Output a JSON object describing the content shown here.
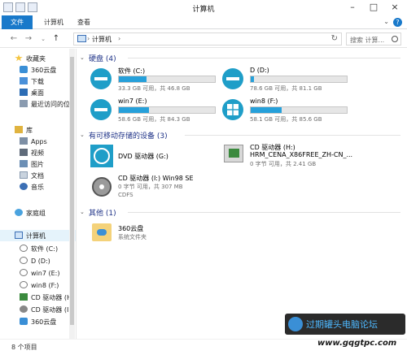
{
  "window": {
    "title": "计算机"
  },
  "ribbon": {
    "tabs": [
      "文件",
      "计算机",
      "查看"
    ]
  },
  "address": {
    "crumb": "计算机",
    "sep1": "›",
    "sep2": "›"
  },
  "search": {
    "placeholder": "搜索 计算..."
  },
  "sidebar": {
    "favorites": "收藏夹",
    "fav_items": [
      "360云盘",
      "下载",
      "桌面",
      "最近访问的位"
    ],
    "libraries": "库",
    "lib_items": [
      "Apps",
      "视频",
      "图片",
      "文档",
      "音乐"
    ],
    "homegroup": "家庭组",
    "computer": "计算机",
    "drives": [
      "软件 (C:)",
      "D (D:)",
      "win7 (E:)",
      "win8 (F:)",
      "CD 驱动器 (H:",
      "CD 驱动器 (I:",
      "360云盘"
    ]
  },
  "groups": {
    "hdd": "硬盘 (4)",
    "removable": "有可移动存储的设备 (3)",
    "other": "其他 (1)"
  },
  "drives": [
    {
      "name": "软件 (C:)",
      "info": "33.3 GB 可用，共 46.8 GB",
      "used_fraction": 0.29
    },
    {
      "name": "D (D:)",
      "info": "78.6 GB 可用，共 81.1 GB",
      "used_fraction": 0.03
    },
    {
      "name": "win7 (E:)",
      "info": "58.6 GB 可用，共 84.3 GB",
      "used_fraction": 0.31
    },
    {
      "name": "win8 (F:)",
      "info": "58.1 GB 可用，共 85.6 GB",
      "used_fraction": 0.32
    }
  ],
  "devices": {
    "dvd": {
      "name": "DVD 驱动器 (G:)"
    },
    "cdh": {
      "name": "CD 驱动器 (H:)",
      "label": "HRM_CENA_X86FREE_ZH-CN_...",
      "info": "0 字节 可用，共 2.41 GB"
    },
    "cdi": {
      "name": "CD 驱动器 (I:) Win98 SE",
      "info": "0 字节 可用，共 307 MB",
      "fs": "CDFS"
    }
  },
  "other": {
    "name": "360云盘",
    "type": "系统文件夹"
  },
  "status": {
    "count": "8 个项目"
  },
  "watermark": {
    "text": "过期罐头电脑论坛",
    "url": "www.gqgtpc.com"
  },
  "colors": {
    "accent": "#1979ca",
    "drive_icon": "#1f9ec8",
    "bar_fill": "#26a0da",
    "group_header": "#1e3287"
  }
}
